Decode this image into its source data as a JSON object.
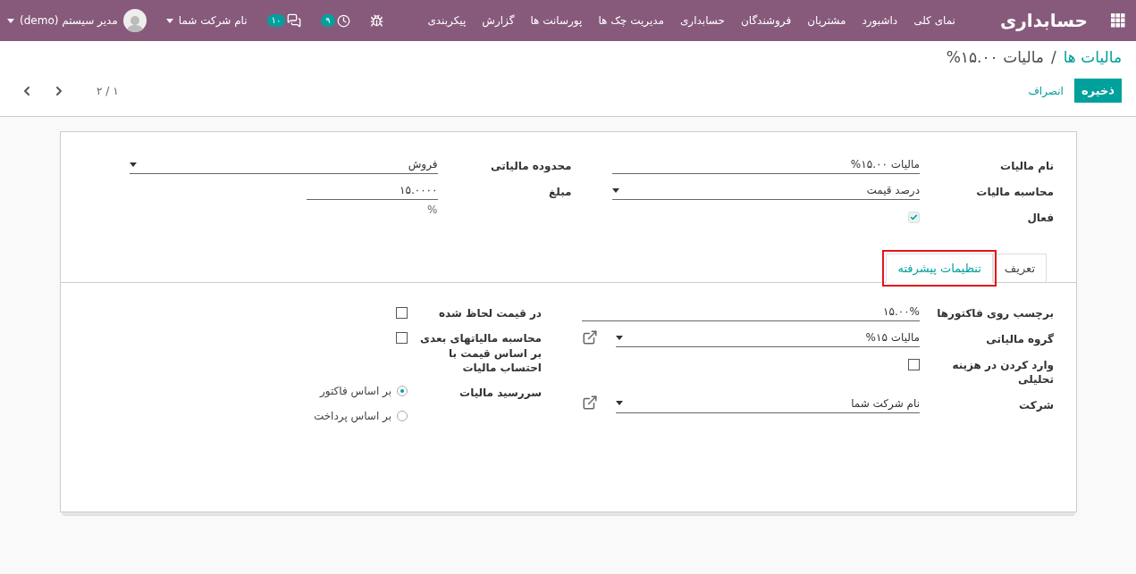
{
  "navbar": {
    "brand": "حسابداری",
    "menu": [
      "نمای کلی",
      "داشبورد",
      "مشتریان",
      "فروشندگان",
      "حسابداری",
      "مدیریت چک ها",
      "پورسانت ها",
      "گزارش",
      "پیکربندی"
    ],
    "systray": [
      {
        "kind": "debug"
      },
      {
        "kind": "activity",
        "badge": "۹"
      },
      {
        "kind": "messages",
        "badge": "۱۰"
      }
    ],
    "company": "نام شرکت شما",
    "user": "مدیر سیستم (demo)"
  },
  "breadcrumb": {
    "parent": "مالیات ها",
    "separator": "/",
    "current": "مالیات ۱۵.۰۰%"
  },
  "buttons": {
    "save": "ذخیره",
    "discard": "انصراف"
  },
  "pager": "۱ / ۲",
  "main_fields": {
    "right": [
      {
        "kind": "input",
        "label": "نام مالیات",
        "value": "مالیات ۱۵.۰۰%"
      },
      {
        "kind": "select",
        "label": "محاسبه مالیات",
        "value": "درصد قیمت"
      },
      {
        "kind": "checkbox",
        "label": "فعال",
        "checked": true
      }
    ],
    "left": [
      {
        "kind": "select",
        "label": "محدوده مالیاتی",
        "value": "فروش"
      },
      {
        "kind": "input",
        "label": "مبلغ",
        "value": "۱۵.۰۰۰۰",
        "unit": "%"
      }
    ]
  },
  "tabs": [
    {
      "label": "تعریف",
      "selected": false,
      "highlighted": false
    },
    {
      "label": "تنظیمات پیشرفته",
      "selected": true,
      "highlighted": true
    }
  ],
  "advanced_fields": {
    "right": [
      {
        "kind": "input",
        "label": "برچسب روی فاکتورها",
        "value": "۱۵.۰۰%"
      },
      {
        "kind": "select",
        "label": "گروه مالیاتی",
        "value": "مالیات ۱۵%",
        "link": true
      },
      {
        "kind": "checkbox",
        "label": "وارد کردن در هزینه تحلیلی",
        "checked": false
      },
      {
        "kind": "select",
        "label": "شرکت",
        "value": "نام شرکت شما",
        "link": true
      }
    ],
    "left": [
      {
        "kind": "checkbox",
        "label": "در قیمت لحاظ شده",
        "checked": false
      },
      {
        "kind": "checkbox",
        "label": "محاسبه مالیاتهای بعدی بر اساس قیمت با احتساب مالیات",
        "checked": false
      },
      {
        "kind": "radio",
        "label": "سررسید مالیات",
        "options": [
          {
            "label": "بر اساس فاکتور",
            "selected": true
          },
          {
            "label": "بر اساس پرداخت",
            "selected": false
          }
        ]
      }
    ]
  }
}
